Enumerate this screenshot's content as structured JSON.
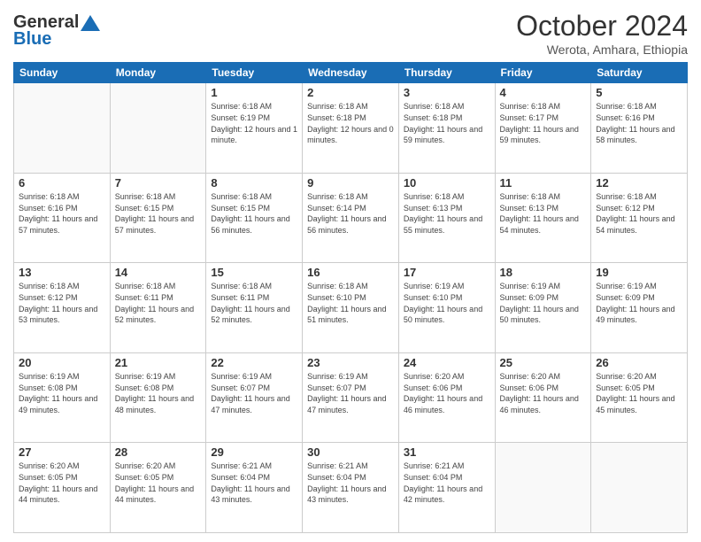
{
  "header": {
    "logo_line1": "General",
    "logo_line2": "Blue",
    "title": "October 2024",
    "subtitle": "Werota, Amhara, Ethiopia"
  },
  "calendar": {
    "weekdays": [
      "Sunday",
      "Monday",
      "Tuesday",
      "Wednesday",
      "Thursday",
      "Friday",
      "Saturday"
    ],
    "weeks": [
      [
        {
          "day": "",
          "sunrise": "",
          "sunset": "",
          "daylight": ""
        },
        {
          "day": "",
          "sunrise": "",
          "sunset": "",
          "daylight": ""
        },
        {
          "day": "1",
          "sunrise": "Sunrise: 6:18 AM",
          "sunset": "Sunset: 6:19 PM",
          "daylight": "Daylight: 12 hours and 1 minute."
        },
        {
          "day": "2",
          "sunrise": "Sunrise: 6:18 AM",
          "sunset": "Sunset: 6:18 PM",
          "daylight": "Daylight: 12 hours and 0 minutes."
        },
        {
          "day": "3",
          "sunrise": "Sunrise: 6:18 AM",
          "sunset": "Sunset: 6:18 PM",
          "daylight": "Daylight: 11 hours and 59 minutes."
        },
        {
          "day": "4",
          "sunrise": "Sunrise: 6:18 AM",
          "sunset": "Sunset: 6:17 PM",
          "daylight": "Daylight: 11 hours and 59 minutes."
        },
        {
          "day": "5",
          "sunrise": "Sunrise: 6:18 AM",
          "sunset": "Sunset: 6:16 PM",
          "daylight": "Daylight: 11 hours and 58 minutes."
        }
      ],
      [
        {
          "day": "6",
          "sunrise": "Sunrise: 6:18 AM",
          "sunset": "Sunset: 6:16 PM",
          "daylight": "Daylight: 11 hours and 57 minutes."
        },
        {
          "day": "7",
          "sunrise": "Sunrise: 6:18 AM",
          "sunset": "Sunset: 6:15 PM",
          "daylight": "Daylight: 11 hours and 57 minutes."
        },
        {
          "day": "8",
          "sunrise": "Sunrise: 6:18 AM",
          "sunset": "Sunset: 6:15 PM",
          "daylight": "Daylight: 11 hours and 56 minutes."
        },
        {
          "day": "9",
          "sunrise": "Sunrise: 6:18 AM",
          "sunset": "Sunset: 6:14 PM",
          "daylight": "Daylight: 11 hours and 56 minutes."
        },
        {
          "day": "10",
          "sunrise": "Sunrise: 6:18 AM",
          "sunset": "Sunset: 6:13 PM",
          "daylight": "Daylight: 11 hours and 55 minutes."
        },
        {
          "day": "11",
          "sunrise": "Sunrise: 6:18 AM",
          "sunset": "Sunset: 6:13 PM",
          "daylight": "Daylight: 11 hours and 54 minutes."
        },
        {
          "day": "12",
          "sunrise": "Sunrise: 6:18 AM",
          "sunset": "Sunset: 6:12 PM",
          "daylight": "Daylight: 11 hours and 54 minutes."
        }
      ],
      [
        {
          "day": "13",
          "sunrise": "Sunrise: 6:18 AM",
          "sunset": "Sunset: 6:12 PM",
          "daylight": "Daylight: 11 hours and 53 minutes."
        },
        {
          "day": "14",
          "sunrise": "Sunrise: 6:18 AM",
          "sunset": "Sunset: 6:11 PM",
          "daylight": "Daylight: 11 hours and 52 minutes."
        },
        {
          "day": "15",
          "sunrise": "Sunrise: 6:18 AM",
          "sunset": "Sunset: 6:11 PM",
          "daylight": "Daylight: 11 hours and 52 minutes."
        },
        {
          "day": "16",
          "sunrise": "Sunrise: 6:18 AM",
          "sunset": "Sunset: 6:10 PM",
          "daylight": "Daylight: 11 hours and 51 minutes."
        },
        {
          "day": "17",
          "sunrise": "Sunrise: 6:19 AM",
          "sunset": "Sunset: 6:10 PM",
          "daylight": "Daylight: 11 hours and 50 minutes."
        },
        {
          "day": "18",
          "sunrise": "Sunrise: 6:19 AM",
          "sunset": "Sunset: 6:09 PM",
          "daylight": "Daylight: 11 hours and 50 minutes."
        },
        {
          "day": "19",
          "sunrise": "Sunrise: 6:19 AM",
          "sunset": "Sunset: 6:09 PM",
          "daylight": "Daylight: 11 hours and 49 minutes."
        }
      ],
      [
        {
          "day": "20",
          "sunrise": "Sunrise: 6:19 AM",
          "sunset": "Sunset: 6:08 PM",
          "daylight": "Daylight: 11 hours and 49 minutes."
        },
        {
          "day": "21",
          "sunrise": "Sunrise: 6:19 AM",
          "sunset": "Sunset: 6:08 PM",
          "daylight": "Daylight: 11 hours and 48 minutes."
        },
        {
          "day": "22",
          "sunrise": "Sunrise: 6:19 AM",
          "sunset": "Sunset: 6:07 PM",
          "daylight": "Daylight: 11 hours and 47 minutes."
        },
        {
          "day": "23",
          "sunrise": "Sunrise: 6:19 AM",
          "sunset": "Sunset: 6:07 PM",
          "daylight": "Daylight: 11 hours and 47 minutes."
        },
        {
          "day": "24",
          "sunrise": "Sunrise: 6:20 AM",
          "sunset": "Sunset: 6:06 PM",
          "daylight": "Daylight: 11 hours and 46 minutes."
        },
        {
          "day": "25",
          "sunrise": "Sunrise: 6:20 AM",
          "sunset": "Sunset: 6:06 PM",
          "daylight": "Daylight: 11 hours and 46 minutes."
        },
        {
          "day": "26",
          "sunrise": "Sunrise: 6:20 AM",
          "sunset": "Sunset: 6:05 PM",
          "daylight": "Daylight: 11 hours and 45 minutes."
        }
      ],
      [
        {
          "day": "27",
          "sunrise": "Sunrise: 6:20 AM",
          "sunset": "Sunset: 6:05 PM",
          "daylight": "Daylight: 11 hours and 44 minutes."
        },
        {
          "day": "28",
          "sunrise": "Sunrise: 6:20 AM",
          "sunset": "Sunset: 6:05 PM",
          "daylight": "Daylight: 11 hours and 44 minutes."
        },
        {
          "day": "29",
          "sunrise": "Sunrise: 6:21 AM",
          "sunset": "Sunset: 6:04 PM",
          "daylight": "Daylight: 11 hours and 43 minutes."
        },
        {
          "day": "30",
          "sunrise": "Sunrise: 6:21 AM",
          "sunset": "Sunset: 6:04 PM",
          "daylight": "Daylight: 11 hours and 43 minutes."
        },
        {
          "day": "31",
          "sunrise": "Sunrise: 6:21 AM",
          "sunset": "Sunset: 6:04 PM",
          "daylight": "Daylight: 11 hours and 42 minutes."
        },
        {
          "day": "",
          "sunrise": "",
          "sunset": "",
          "daylight": ""
        },
        {
          "day": "",
          "sunrise": "",
          "sunset": "",
          "daylight": ""
        }
      ]
    ]
  }
}
